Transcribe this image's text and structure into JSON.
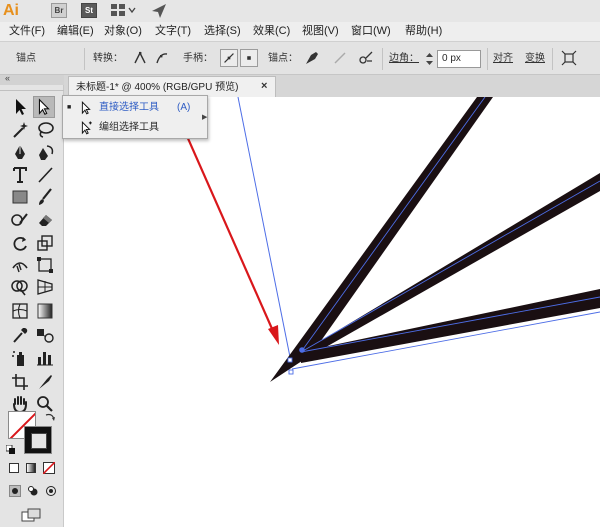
{
  "app": {
    "logo": "Ai",
    "bridge_label": "Br",
    "stock_label": "St"
  },
  "menu": [
    "文件(F)",
    "编辑(E)",
    "对象(O)",
    "文字(T)",
    "选择(S)",
    "效果(C)",
    "视图(V)",
    "窗口(W)",
    "帮助(H)"
  ],
  "control_bar": {
    "selection_label": "锚点",
    "convert_label": "转换：",
    "handles_label": "手柄：",
    "anchors_label": "锚点：",
    "corners_label": "边角：",
    "corner_value": "0 px",
    "align_label": "对齐",
    "transform_label": "变换"
  },
  "document_tab": {
    "label": "未标题-1* @ 400% (RGB/GPU 预览)",
    "close": "×"
  },
  "flyout": {
    "items": [
      {
        "label": "直接选择工具",
        "shortcut": "(A)",
        "icon": "direct-selection-icon"
      },
      {
        "label": "编组选择工具",
        "shortcut": "",
        "icon": "group-selection-icon"
      }
    ]
  },
  "colors": {
    "stroke_dark": "#1a0f12",
    "path_guide": "#4d6de6",
    "annotation_arrow": "#d9171b",
    "flyout_selected_text": "#2e5cc4"
  }
}
